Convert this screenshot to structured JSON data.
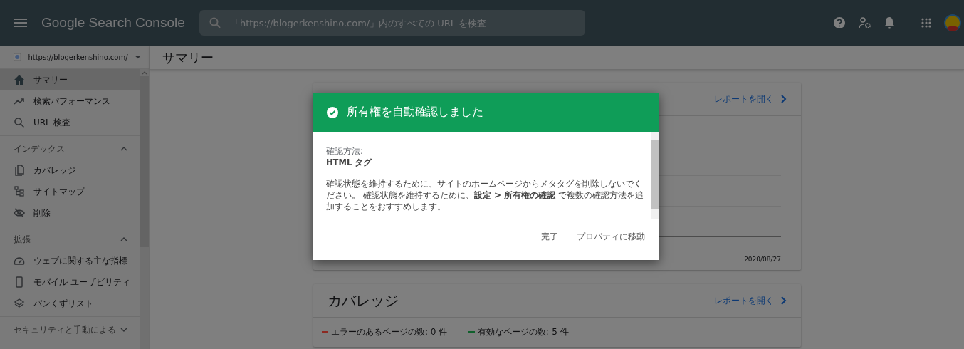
{
  "topbar": {
    "product": "Google Search Console",
    "search": {
      "placeholder": "「https://blogerkenshino.com/」内のすべての URL を検査"
    }
  },
  "sidebar": {
    "property": "https://blogerkenshino.com/",
    "items": [
      {
        "label": "サマリー",
        "selected": true
      },
      {
        "label": "検索パフォーマンス",
        "selected": false
      },
      {
        "label": "URL 検査",
        "selected": false
      }
    ],
    "sections": [
      {
        "title": "インデックス",
        "expanded": true,
        "items": [
          {
            "label": "カバレッジ",
            "selected": false
          },
          {
            "label": "サイトマップ",
            "selected": false
          },
          {
            "label": "削除",
            "selected": false
          }
        ]
      },
      {
        "title": "拡張",
        "expanded": true,
        "items": [
          {
            "label": "ウェブに関する主な指標",
            "selected": false
          },
          {
            "label": "モバイル ユーザビリティ",
            "selected": false
          },
          {
            "label": "パンくずリスト",
            "selected": false
          }
        ]
      },
      {
        "title": "セキュリティと手動による",
        "expanded": false
      }
    ]
  },
  "page_title": "サマリー",
  "cards": [
    {
      "link": "レポートを開く",
      "date": "2020/08/27"
    },
    {
      "title": "カバレッジ",
      "link": "レポートを開く",
      "legend": [
        {
          "label": "エラーのあるページの数: 0 件",
          "color": "#8c2a22"
        },
        {
          "label": "有効なページの数: 5 件",
          "color": "#10602c"
        }
      ]
    }
  ],
  "dialog": {
    "title": "所有権を自動確認しました",
    "method_label": "確認方法:",
    "method_value": "HTML タグ",
    "message": "確認状態を維持するために、サイトのホームページからメタタグを削除しないでください。 確認状態を維持するために、**設定 > 所有権の確認** で複数の確認方法を追加することをおすすめします。",
    "buttons": [
      "完了",
      "プロパティに移動"
    ]
  }
}
